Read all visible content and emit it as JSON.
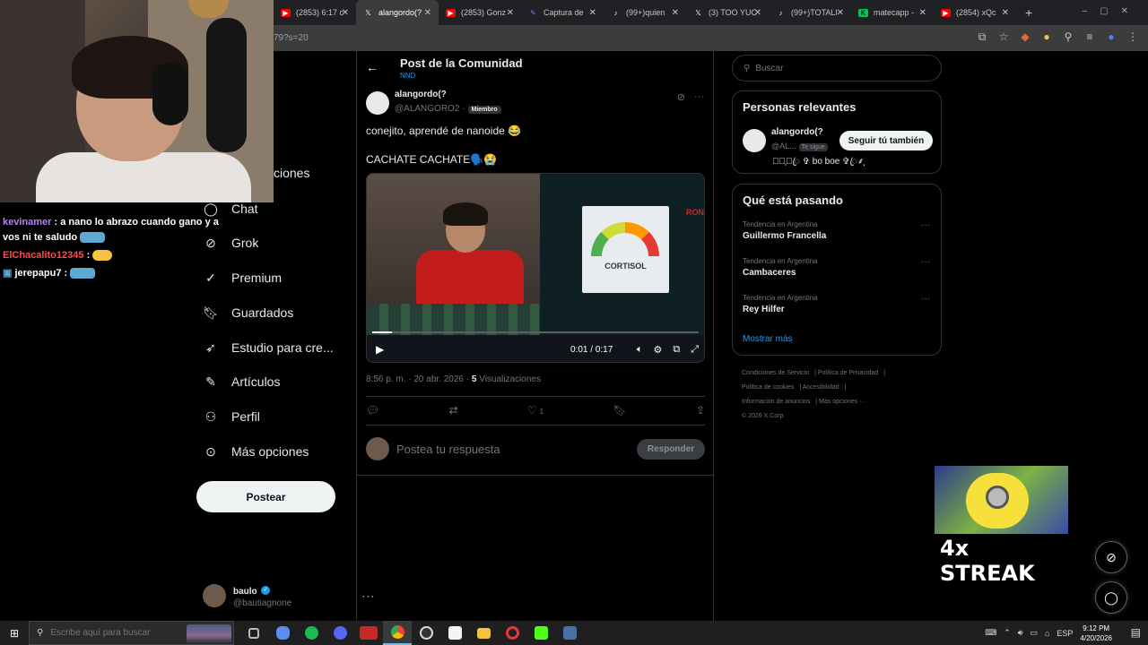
{
  "browser": {
    "tabs": [
      {
        "label": "(2853) 6:17 c",
        "icon_color": "#ff0000",
        "icon": "youtube-icon",
        "active": false
      },
      {
        "label": "alangordo(?",
        "icon_color": "#000000",
        "icon": "x-icon",
        "active": true
      },
      {
        "label": "(2853) Gonz",
        "icon_color": "#ff0000",
        "icon": "youtube-icon",
        "active": false
      },
      {
        "label": "Captura de",
        "icon_color": "#a06cd5",
        "icon": "pen-icon",
        "active": false
      },
      {
        "label": "(99+)quien",
        "icon_color": "#000000",
        "icon": "tiktok-icon",
        "active": false
      },
      {
        "label": "(3) TOO YUC",
        "icon_color": "#000000",
        "icon": "x-icon",
        "active": false
      },
      {
        "label": "(99+)TOTALI",
        "icon_color": "#000000",
        "icon": "tiktok-icon",
        "active": false
      },
      {
        "label": "matecapp -",
        "icon_color": "#00c853",
        "icon": "kick-icon",
        "active": false
      },
      {
        "label": "(2854) xQc",
        "icon_color": "#ff0000",
        "icon": "youtube-icon",
        "active": false
      }
    ],
    "new_tab": "+",
    "url": "79?s=20"
  },
  "chat": [
    {
      "user": "kevinamer",
      "text": ": a nano lo abrazo cuando gano y a vos ni te saludo",
      "color": "#b084f5"
    },
    {
      "user": "ElChacalito12345",
      "text": ":",
      "color": "#ff4a4a"
    },
    {
      "user": "jerepapu7",
      "text": ":",
      "color": "#ffffff"
    }
  ],
  "nav": {
    "partial_item": "ciones",
    "items": [
      {
        "label": "Chat",
        "icon": "chat-icon"
      },
      {
        "label": "Grok",
        "icon": "grok-icon"
      },
      {
        "label": "Premium",
        "icon": "premium-icon"
      },
      {
        "label": "Guardados",
        "icon": "bookmark-icon"
      },
      {
        "label": "Estudio para cre...",
        "icon": "rocket-icon"
      },
      {
        "label": "Artículos",
        "icon": "article-icon"
      },
      {
        "label": "Perfil",
        "icon": "profile-icon"
      },
      {
        "label": "Más opciones",
        "icon": "more-icon"
      }
    ],
    "post_button": "Postear",
    "account": {
      "name": "baulo",
      "handle": "@bautiagnone"
    }
  },
  "post": {
    "header_title": "Post de la Comunidad",
    "header_sub": "NND",
    "author_name": "alangordo(?",
    "author_handle": "@ALANGORO2 ·",
    "badge": "Miembro",
    "text1": "conejito, aprendé de nanoide 😂",
    "text2": "CACHATE CACHATE🗣️😭",
    "video": {
      "time": "0:01 / 0:17",
      "progress": 0.06,
      "overlay_cortisol": "CORTISOL",
      "overlay_ron": "RON"
    },
    "meta_time": "8:56 p. m. · 20 abr. 2026 ·",
    "views_count": "5",
    "views_label": "Visualizaciones",
    "likes": "1",
    "reply_placeholder": "Postea tu respuesta",
    "reply_button": "Responder"
  },
  "sidebar": {
    "search_placeholder": "Buscar",
    "relevant_title": "Personas relevantes",
    "relevant_user": {
      "name": "alangordo(?",
      "handle": "@AL...",
      "follows_you": "Te sigue",
      "bio": "⸙͎۪۫ꦿ ✞ bo boe ✞ꦿ⸙͎",
      "follow_button": "Seguir tú también"
    },
    "trends_title": "Qué está pasando",
    "trends": [
      {
        "context": "Tendencia en Argentina",
        "name": "Guillermo Francella"
      },
      {
        "context": "Tendencia en Argentina",
        "name": "Cambaceres"
      },
      {
        "context": "Tendencia en Argentina",
        "name": "Rey Hilfer"
      }
    ],
    "show_more": "Mostrar más",
    "footer": [
      "Condiciones de Servicio",
      "Política de Privacidad",
      "Política de cookies",
      "Accesibilidad",
      "Información de anuncios",
      "Más opciones ···",
      "© 2026 X Corp."
    ]
  },
  "streak": {
    "text": "4x STREAK"
  },
  "taskbar": {
    "search_placeholder": "Escribe aquí para buscar",
    "language": "ESP",
    "time": "9:12 PM",
    "date": "4/20/2026",
    "apps": [
      {
        "icon": "task-view-icon",
        "color": "#555555"
      },
      {
        "icon": "copilot-icon",
        "color": "#5a8dee"
      },
      {
        "icon": "spotify-icon",
        "color": "#1db954"
      },
      {
        "icon": "discord-icon",
        "color": "#5865f2"
      },
      {
        "icon": "app-red-icon",
        "color": "#c62828"
      },
      {
        "icon": "chrome-icon",
        "color": "#4285f4"
      },
      {
        "icon": "obs-icon",
        "color": "#333333"
      },
      {
        "icon": "capcut-icon",
        "color": "#222222"
      },
      {
        "icon": "folder-icon",
        "color": "#f5c242"
      },
      {
        "icon": "opera-icon",
        "color": "#e53935"
      },
      {
        "icon": "kick-icon",
        "color": "#53fc18"
      },
      {
        "icon": "calculator-icon",
        "color": "#4a6fa5"
      }
    ]
  }
}
